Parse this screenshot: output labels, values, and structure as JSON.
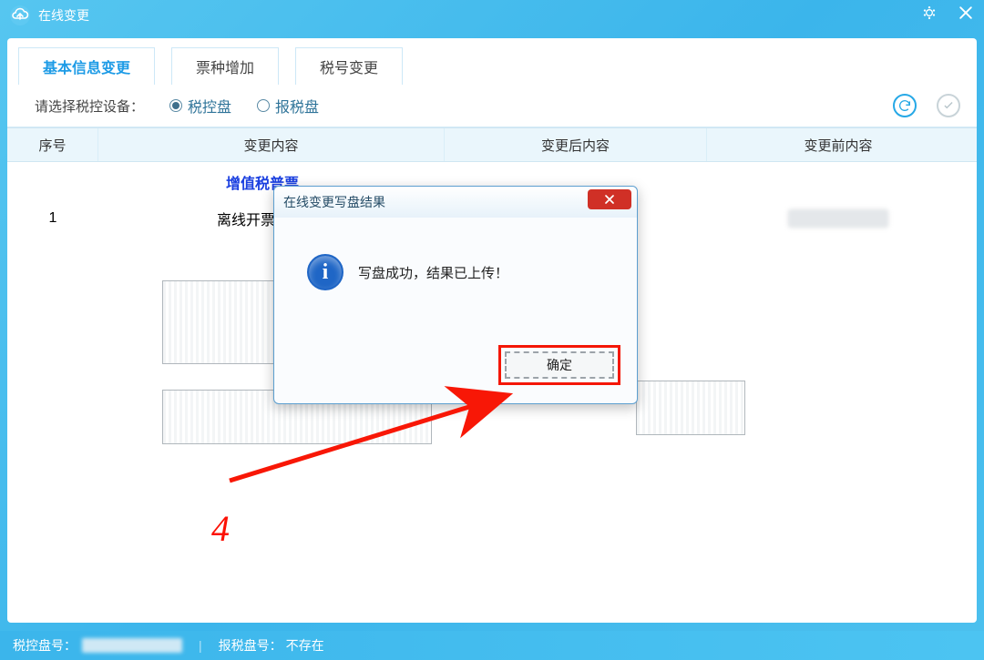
{
  "window_title": "在线变更",
  "tabs": {
    "t1": "基本信息变更",
    "t2": "票种增加",
    "t3": "税号变更"
  },
  "device": {
    "label": "请选择税控设备：",
    "opt1": "税控盘",
    "opt2": "报税盘"
  },
  "grid": {
    "col1": "序号",
    "col2": "变更内容",
    "col3": "变更后内容",
    "col4": "变更前内容",
    "category": "增值税普票",
    "row1_no": "1",
    "row1_item": "离线开票限额"
  },
  "dialog": {
    "title": "在线变更写盘结果",
    "message": "写盘成功，结果已上传！",
    "confirm": "确定"
  },
  "annotation": {
    "step": "4"
  },
  "footer": {
    "left_label": "税控盘号：",
    "right_label": "报税盘号：",
    "right_value": "不存在"
  }
}
